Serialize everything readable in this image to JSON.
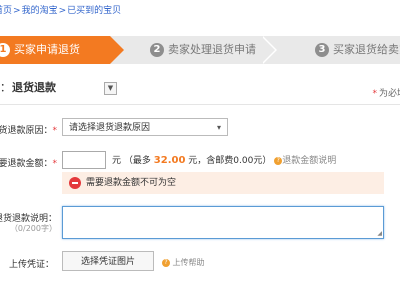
{
  "breadcrumb": {
    "items": [
      "首页",
      "我的淘宝",
      "已买到的宝贝"
    ],
    "separator": ">"
  },
  "steps": [
    {
      "num": "1",
      "label": "买家申请退货"
    },
    {
      "num": "2",
      "label": "卖家处理退货申请"
    },
    {
      "num": "3",
      "label": "买家退货给卖家"
    }
  ],
  "service": {
    "label_fragment": "：",
    "value": "退货退款",
    "dropdown_icon": "triangle-down"
  },
  "required_note": {
    "star": "*",
    "text": "为必填"
  },
  "form": {
    "reason": {
      "label": "退货退款原因：",
      "star": "*",
      "placeholder": "请选择退货退款原因",
      "chevron": "⌄"
    },
    "amount": {
      "label": "需要退款金额：",
      "star": "*",
      "value": "",
      "unit": "元",
      "max_prefix": "（最多",
      "max_value": "32.00",
      "max_suffix": "元，含邮费0.00元）",
      "help_icon": "?",
      "help_text": "退款金额说明"
    },
    "error": {
      "text": "需要退款金额不可为空",
      "icon": "minus-circle-icon"
    },
    "description": {
      "label": "退货退款说明：",
      "counter": "（0/200字）",
      "value": ""
    },
    "upload": {
      "label": "上传凭证：",
      "button": "选择凭证图片",
      "help_text": "上传帮助"
    }
  },
  "colors": {
    "accent": "#f37a21",
    "error": "#e4393c",
    "link": "#3366cc",
    "error_bg": "#fdeee4",
    "focus": "#5b9bd5"
  }
}
